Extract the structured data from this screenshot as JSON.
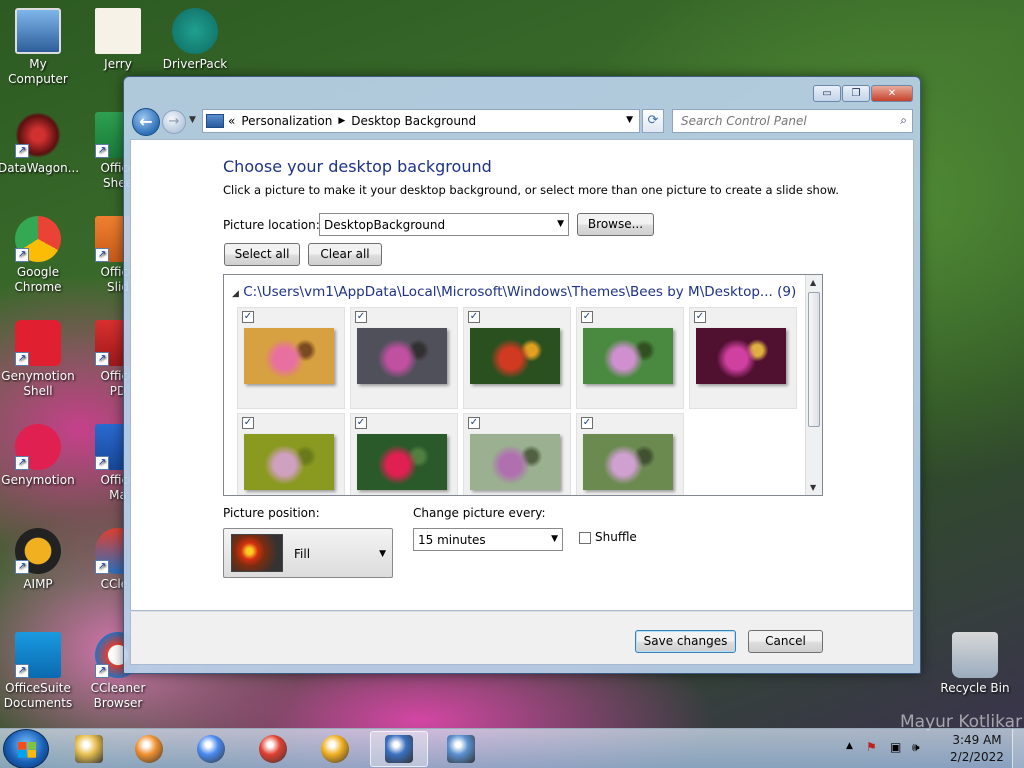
{
  "desktop": {
    "icons": [
      {
        "label": "My Computer"
      },
      {
        "label": "Jerry"
      },
      {
        "label": "DriverPack"
      },
      {
        "label": "DataWagon..."
      },
      {
        "label": "Office\nShee"
      },
      {
        "label": "Google\nChrome"
      },
      {
        "label": "Office\nSlid"
      },
      {
        "label": "Genymotion\nShell"
      },
      {
        "label": "Office\nPD"
      },
      {
        "label": "Genymotion"
      },
      {
        "label": "Office\nMa"
      },
      {
        "label": "AIMP"
      },
      {
        "label": "CClea"
      },
      {
        "label": "OfficeSuite\nDocuments"
      },
      {
        "label": "CCleaner\nBrowser"
      },
      {
        "label": "Recycle Bin"
      }
    ],
    "watermark": "Mayur Kotlikar"
  },
  "window": {
    "controls": {
      "minimize": "▭",
      "maximize": "❐",
      "close": "✕"
    },
    "nav": {
      "back": "←",
      "forward": "→"
    },
    "address": {
      "prefix": "«",
      "crumbs": [
        "Personalization",
        "Desktop Background"
      ]
    },
    "search_placeholder": "Search Control Panel",
    "title": "Choose your desktop background",
    "description": "Click a picture to make it your desktop background, or select more than one picture to create a slide show.",
    "picture_location": {
      "label": "Picture location:",
      "value": "DesktopBackground",
      "browse": "Browse..."
    },
    "select_all": "Select all",
    "clear_all": "Clear all",
    "group_header": "C:\\Users\\vm1\\AppData\\Local\\Microsoft\\Windows\\Themes\\Bees by M\\Desktop... (9)",
    "pictures": [
      {
        "checked": true,
        "colors": [
          "#d7a040",
          "#e870a0",
          "#7a4a20"
        ]
      },
      {
        "checked": true,
        "colors": [
          "#50505a",
          "#c050a0",
          "#303030"
        ]
      },
      {
        "checked": true,
        "colors": [
          "#2a5020",
          "#d03a20",
          "#e0a020"
        ]
      },
      {
        "checked": true,
        "colors": [
          "#4a8a40",
          "#d090d0",
          "#305020"
        ]
      },
      {
        "checked": true,
        "colors": [
          "#501030",
          "#d040a0",
          "#e0b040"
        ]
      },
      {
        "checked": true,
        "colors": [
          "#8a9a20",
          "#d0a0c0",
          "#6a7a18"
        ]
      },
      {
        "checked": true,
        "colors": [
          "#2a5a2a",
          "#e02050",
          "#508040"
        ]
      },
      {
        "checked": true,
        "colors": [
          "#9ab090",
          "#b070b0",
          "#506040"
        ]
      },
      {
        "checked": true,
        "colors": [
          "#6a8a50",
          "#d0a0d0",
          "#405030"
        ]
      }
    ],
    "picture_position": {
      "label": "Picture position:",
      "value": "Fill"
    },
    "change_every": {
      "label": "Change picture every:",
      "value": "15 minutes"
    },
    "shuffle": {
      "label": "Shuffle",
      "checked": false
    },
    "save": "Save changes",
    "cancel": "Cancel"
  },
  "taskbar": {
    "items": [
      {
        "name": "explorer",
        "color": "#e8c050"
      },
      {
        "name": "media-player",
        "color": "#f09030"
      },
      {
        "name": "chrome",
        "color": "#4a8af0"
      },
      {
        "name": "ccleaner",
        "color": "#e04030"
      },
      {
        "name": "avast-browser",
        "color": "#f0b020"
      },
      {
        "name": "personalization",
        "color": "#3a70c0",
        "active": true
      },
      {
        "name": "control-panel",
        "color": "#5a90d0"
      }
    ],
    "time": "3:49 AM",
    "date": "2/2/2022"
  }
}
